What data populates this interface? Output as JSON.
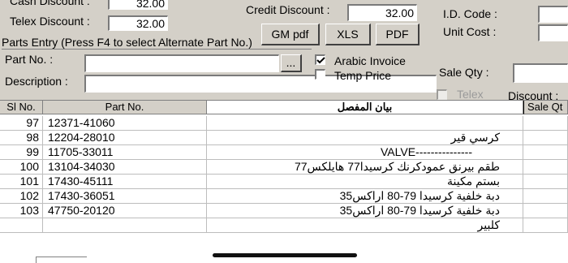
{
  "header": {
    "cash_discount_label": "Cash Discount :",
    "cash_discount_value": "32.00",
    "telex_discount_label": "Telex Discount :",
    "telex_discount_value": "32.00",
    "credit_discount_label": "Credit Discount :",
    "credit_discount_value": "32.00",
    "id_code_label": "I.D. Code :",
    "unit_cost_label": "Unit Cost :"
  },
  "buttons": {
    "gm_pdf": "GM pdf",
    "xls": "XLS",
    "pdf": "PDF",
    "browse": "..."
  },
  "parts_entry": {
    "group_label": "Parts Entry (Press F4 to select Alternate Part No.)",
    "part_no_label": "Part No. :",
    "description_label": "Description :",
    "arabic_invoice_label": "Arabic Invoice",
    "arabic_invoice_checked": true,
    "temp_price_label": "Temp Price",
    "temp_price_checked": false,
    "sale_qty_label": "Sale Qty :",
    "telex_label": "Telex",
    "discount_label": "Discount :"
  },
  "table": {
    "columns": [
      "Sl No.",
      "Part No.",
      "بيان المفصل",
      "Sale Qt"
    ],
    "rows": [
      {
        "sl": "97",
        "part": "12371-41060",
        "desc": ""
      },
      {
        "sl": "98",
        "part": "12204-28010",
        "desc": "كرسي قير"
      },
      {
        "sl": "99",
        "part": "11705-33011",
        "desc": "VALVE---------------"
      },
      {
        "sl": "100",
        "part": "13104-34030",
        "desc": "طقم بيرنق عمودكرنك كرسيدا77 هايلكس77"
      },
      {
        "sl": "101",
        "part": "17430-45111",
        "desc": "بستم مكينة"
      },
      {
        "sl": "102",
        "part": "17430-36051",
        "desc": "دبة خلفية كرسيدا 79-80 اراكس35"
      },
      {
        "sl": "103",
        "part": "47750-20120",
        "desc": "دبة خلفية كرسيدا 79-80 اراكس35"
      },
      {
        "sl": "",
        "part": "",
        "desc": "كلبير"
      }
    ]
  }
}
